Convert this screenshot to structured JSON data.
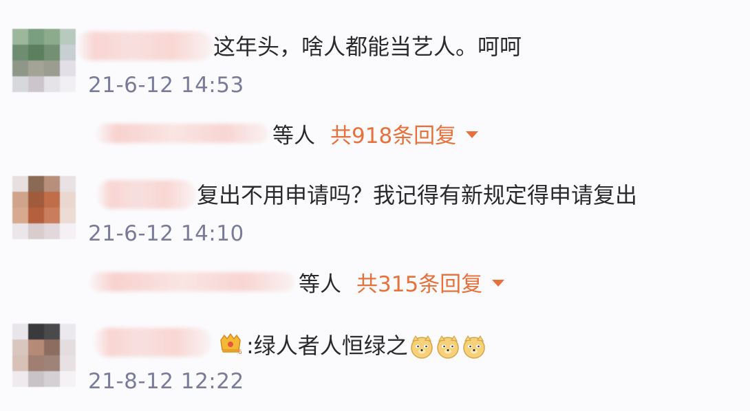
{
  "comments": [
    {
      "text": "这年头，啥人都能当艺人。呵呵",
      "time": "21-6-12 14:53",
      "replies": {
        "who": "等人",
        "count": "共918条回复"
      }
    },
    {
      "text": "复出不用申请吗？我记得有新规定得申请复出",
      "time": "21-6-12 14:10",
      "replies": {
        "who": "等人",
        "count": "共315条回复"
      }
    },
    {
      "text": ":绿人者人恒绿之",
      "time": "21-8-12 12:22",
      "emoji_icons": [
        "doge-emoji-icon",
        "doge-emoji-icon",
        "doge-emoji-icon"
      ],
      "badge_icon": "crown-medal-icon"
    }
  ],
  "colors": {
    "accent": "#e8703a",
    "timestamp": "#7a7a9a",
    "text": "#2a2a2a",
    "background": "#fbfbfd"
  },
  "icons": {
    "expand": "caret-down-icon"
  }
}
